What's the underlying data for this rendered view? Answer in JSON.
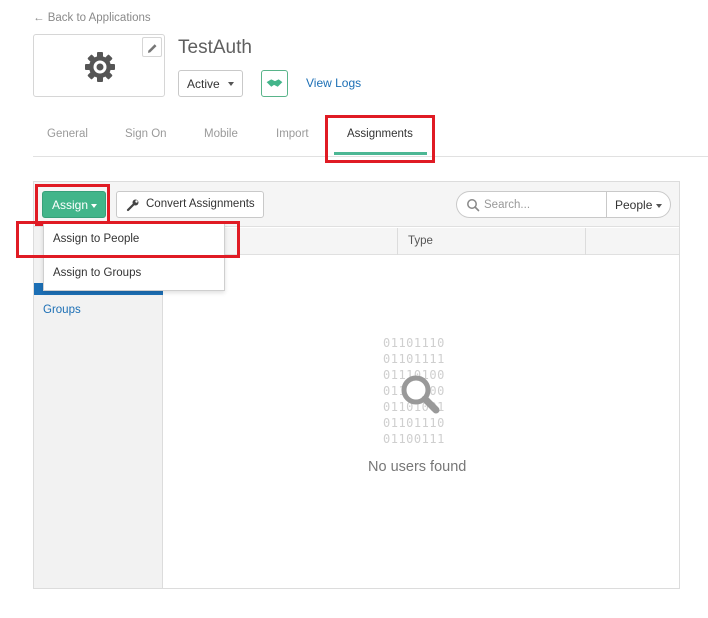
{
  "header": {
    "back_link": "← Back to Applications",
    "app_title": "TestAuth",
    "status": "Active",
    "view_logs": "View Logs"
  },
  "tabs": [
    {
      "label": "General",
      "active": false
    },
    {
      "label": "Sign On",
      "active": false
    },
    {
      "label": "Mobile",
      "active": false
    },
    {
      "label": "Import",
      "active": false
    },
    {
      "label": "Assignments",
      "active": true
    }
  ],
  "toolbar": {
    "assign_label": "Assign",
    "convert_label": "Convert Assignments",
    "search_placeholder": "Search...",
    "filter_value": "People"
  },
  "assign_menu": {
    "items": [
      "Assign to People",
      "Assign to Groups"
    ]
  },
  "left_nav": {
    "groups_label": "Groups"
  },
  "table": {
    "columns": [
      "",
      "Type",
      ""
    ]
  },
  "empty_state": {
    "binary_lines": [
      "01101110",
      "01101111",
      "01110100",
      "01100000",
      "01101001",
      "01101110",
      "01100111"
    ],
    "message": "No users found"
  },
  "colors": {
    "accent_green": "#42b58a",
    "link_blue": "#1c6fb5",
    "highlight_red": "#e01b24"
  },
  "icons": [
    "gear-icon",
    "pencil-icon",
    "handshake-icon",
    "wrench-icon",
    "search-icon",
    "caret-down-icon",
    "magnifier-icon"
  ]
}
